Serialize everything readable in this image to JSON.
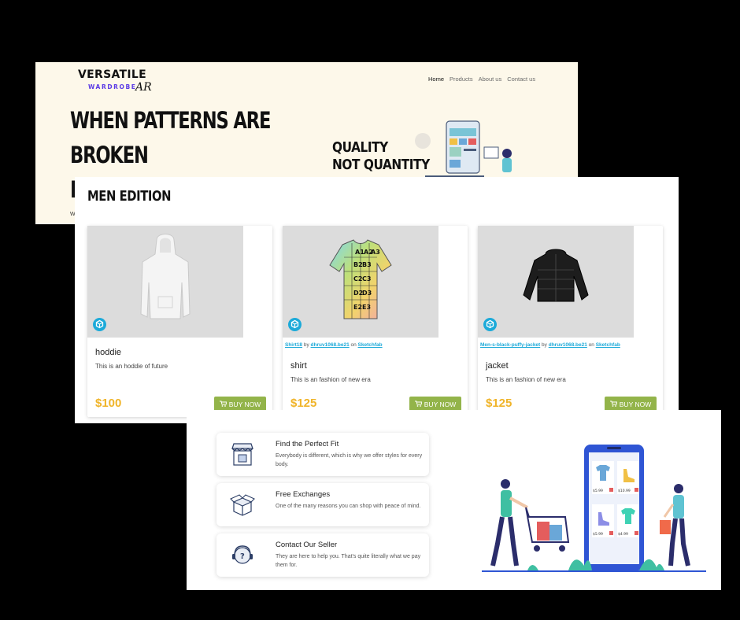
{
  "hero": {
    "logo_main": "VERSATILE",
    "logo_sub": "WARDROBE",
    "logo_ar": "AR",
    "nav": [
      "Home",
      "Products",
      "About us",
      "Contact us"
    ],
    "headline_line1": "WHEN PATTERNS ARE",
    "headline_line2": "BROKEN",
    "headline_line3": "N",
    "tagline": "W",
    "quality_line1": "QUALITY",
    "quality_line2": "NOT QUANTITY"
  },
  "men": {
    "title": "MEN EDITION",
    "cards": [
      {
        "credit_model": "",
        "credit_by": "",
        "credit_author": "",
        "credit_on": "",
        "credit_site": "",
        "name": "hoddie",
        "desc": "This is an hoddie of future",
        "price": "$100",
        "buy": "BUY NOW"
      },
      {
        "credit_model": "Shirt18",
        "credit_by": "by",
        "credit_author": "dhruv1068.be21",
        "credit_on": "on",
        "credit_site": "Sketchfab",
        "name": "shirt",
        "desc": "This is an fashion of new era",
        "price": "$125",
        "buy": "BUY NOW"
      },
      {
        "credit_model": "Men-s-black-puffy-jacket",
        "credit_by": "by",
        "credit_author": "dhruv1068.be21",
        "credit_on": "on",
        "credit_site": "Sketchfab",
        "name": "jacket",
        "desc": "This is an fashion of new era",
        "price": "$125",
        "buy": "BUY NOW"
      }
    ],
    "shirt_grid": [
      "A1",
      "A2",
      "A3",
      "B2",
      "B3",
      "C2",
      "C3",
      "D2",
      "D3",
      "E2",
      "E3"
    ]
  },
  "features": [
    {
      "title": "Find the Perfect Fit",
      "desc": "Everybody is different, which is why we offer styles for every body.",
      "icon": "shop-icon"
    },
    {
      "title": "Free Exchanges",
      "desc": "One of the many reasons you can shop with peace of mind.",
      "icon": "box-icon"
    },
    {
      "title": "Contact Our Seller",
      "desc": "They are here to help you. That's quite literally what we pay them for.",
      "icon": "support-icon"
    }
  ],
  "illustration": {
    "prices": [
      "$5.99",
      "$10.99",
      "$5.99",
      "$4.99"
    ]
  },
  "colors": {
    "hero_bg": "#fdf8ea",
    "price": "#f0b429",
    "buy_button": "#93b44a",
    "link": "#1caad9",
    "brand_purple": "#5b3be5"
  }
}
